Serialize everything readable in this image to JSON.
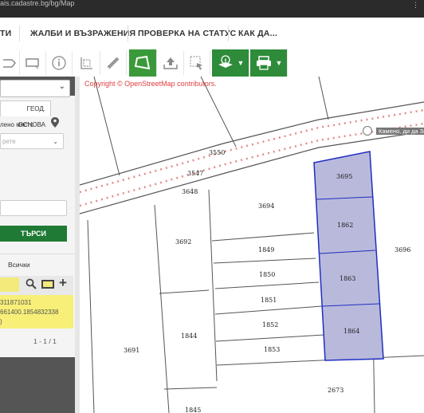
{
  "browser": {
    "url": "ais.cadastre.bg/bg/Map"
  },
  "nav": {
    "items": [
      "ТИ",
      "ЖАЛБИ И ВЪЗРАЖЕНИЯ",
      "ПРОВЕРКА НА СТАТУС",
      "КАК ДА..."
    ]
  },
  "toolbar": {
    "icons": [
      "polygon-tool",
      "rectangle-select",
      "info-icon",
      "measure-area",
      "ruler-icon",
      "polygon-select-active",
      "upload-icon",
      "select-tool",
      "layers-info-icon",
      "print-icon"
    ]
  },
  "panel": {
    "tab_label": "ГЕОД. ОСНОВА",
    "location_label": "лено място",
    "dropdown_placeholder": "рете",
    "search_button": "ТЪРСИ",
    "all_label": "Всички",
    "result_line1": "311871031",
    "result_line2": "661400.1854832338",
    "result_line3": ")",
    "pagination": "1 - 1 / 1"
  },
  "map": {
    "copyright": "Copyright © OpenStreetMap contributors.",
    "road_label": "Камено, ди да За",
    "parcels": [
      "3550",
      "3547",
      "3648",
      "3694",
      "3695",
      "1862",
      "1863",
      "1864",
      "3696",
      "3692",
      "1849",
      "1850",
      "1851",
      "1852",
      "1853",
      "1844",
      "3691",
      "2673",
      "1845"
    ],
    "colors": {
      "selected_fill": "#b9b9dc",
      "selected_stroke": "#1f2fbf",
      "road_dots": "#e38b8b"
    }
  }
}
